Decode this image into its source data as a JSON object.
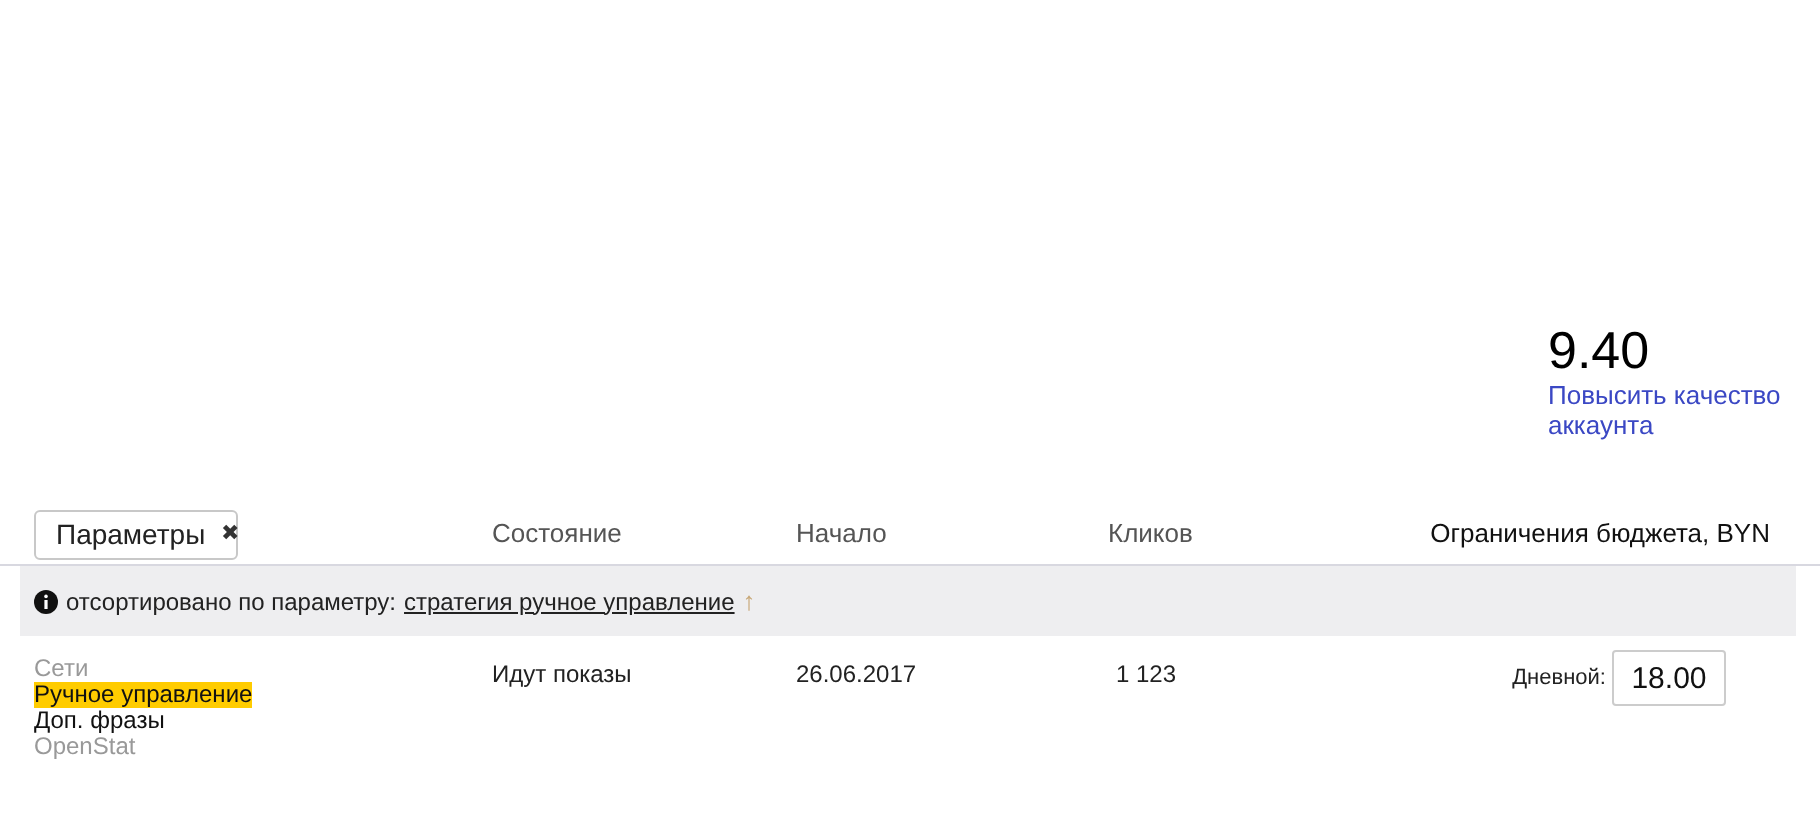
{
  "quality": {
    "score": "9.40",
    "link": "Повысить качество аккаунта"
  },
  "table": {
    "filter_chip": {
      "label": "Параметры",
      "remove": "✖"
    },
    "columns": [
      "Состояние",
      "Начало",
      "Кликов",
      "Ограничения бюджета, BYN"
    ],
    "sort_notice": {
      "text": "отсортировано по параметру:",
      "link": "стратегия ручное управление",
      "arrow": "↑"
    },
    "rows": [
      {
        "parameters": [
          {
            "text": "Сети",
            "kind": "muted"
          },
          {
            "text": "Ручное управление",
            "kind": "highlighted"
          },
          {
            "text": "Доп. фразы",
            "kind": "normal"
          },
          {
            "text": "OpenStat",
            "kind": "muted"
          }
        ],
        "status": "Идут показы",
        "start": "26.06.2017",
        "clicks": "1 123",
        "budget_label": "Дневной:",
        "budget_value": "18.00"
      }
    ]
  }
}
